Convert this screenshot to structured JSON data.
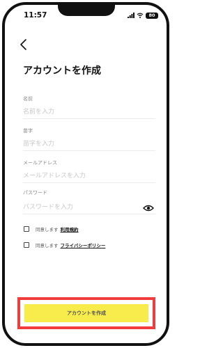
{
  "status_bar": {
    "time": "11:57",
    "battery": "80"
  },
  "header": {
    "title": "アカウントを作成"
  },
  "form": {
    "first_name": {
      "label": "名前",
      "placeholder": "名前を入力"
    },
    "last_name": {
      "label": "苗字",
      "placeholder": "苗字を入力"
    },
    "email": {
      "label": "メールアドレス",
      "placeholder": "メールアドレスを入力"
    },
    "password": {
      "label": "パスワード",
      "placeholder": "パスワードを入力"
    }
  },
  "agreements": [
    {
      "prefix": "同意します",
      "link": "利用規約",
      "checked": false
    },
    {
      "prefix": "同意します",
      "link": "フライバシーポリシー",
      "checked": false
    }
  ],
  "submit": {
    "label": "アカウントを作成"
  },
  "colors": {
    "accent": "#f7ec4b",
    "highlight_frame": "#f03c3c",
    "text": "#111111",
    "placeholder": "#c7c7c7"
  },
  "icons": [
    "back-chevron-icon",
    "signal-icon",
    "wifi-icon",
    "battery-icon",
    "eye-icon"
  ]
}
